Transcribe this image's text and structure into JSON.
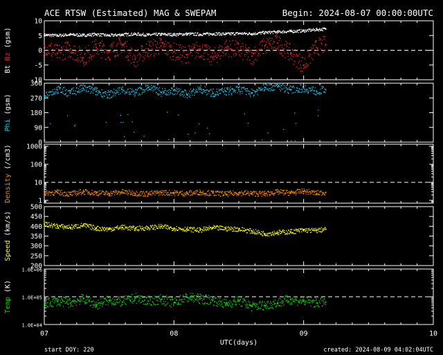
{
  "header": {
    "title": "ACE RTSW (Estimated) MAG & SWEPAM",
    "begin": "Begin: 2024-08-07 00:00:00UTC"
  },
  "footer": {
    "start_doy": "start DOY: 220",
    "created": "created: 2024-08-09 04:02:04UTC"
  },
  "colors": {
    "bt": "#ffffff",
    "bz": "#ff2020",
    "phi": "#22c8ee",
    "density": "#ff8a00",
    "speed": "#ffff00",
    "temp": "#00e000",
    "axis": "#ffffff",
    "background": "#000000"
  },
  "chart_data": [
    {
      "type": "scatter",
      "panel": "mag",
      "ylabel_parts": [
        "Bt",
        "Bz",
        "(gsm)"
      ],
      "ylim": [
        -10,
        10
      ],
      "yticks": [
        "10",
        "5",
        "0",
        "-5",
        "-10"
      ],
      "ref_lines": [
        0
      ],
      "series": [
        {
          "name": "Bt",
          "x": [
            0,
            0.1,
            0.2,
            0.3,
            0.4,
            0.5,
            0.6,
            0.7,
            0.8,
            0.9,
            1.0,
            1.1,
            1.2,
            1.3,
            1.4,
            1.5,
            1.6,
            1.7,
            1.8,
            1.9,
            2.0,
            2.1,
            2.17
          ],
          "values": [
            5.2,
            5.0,
            5.3,
            5.1,
            5.4,
            5.0,
            5.3,
            5.5,
            5.2,
            5.4,
            5.3,
            5.5,
            5.4,
            5.6,
            5.5,
            5.7,
            5.6,
            6.0,
            6.2,
            6.4,
            6.6,
            7.0,
            7.2
          ]
        },
        {
          "name": "Bz",
          "x": [
            0,
            0.1,
            0.2,
            0.3,
            0.4,
            0.5,
            0.6,
            0.7,
            0.8,
            0.9,
            1.0,
            1.1,
            1.2,
            1.3,
            1.4,
            1.5,
            1.6,
            1.7,
            1.8,
            1.9,
            2.0,
            2.1,
            2.17
          ],
          "values": [
            1.5,
            -1.0,
            0.5,
            -2.5,
            1.0,
            -0.5,
            2.0,
            -3.0,
            0.5,
            1.5,
            -0.5,
            -1.5,
            0.5,
            -2.5,
            1.0,
            0.0,
            -2.0,
            1.5,
            2.5,
            -1.0,
            -5.0,
            1.0,
            2.0
          ]
        }
      ]
    },
    {
      "type": "scatter",
      "panel": "phi",
      "ylabel_parts": [
        "Phi",
        "(gsm)"
      ],
      "ylim": [
        0,
        360
      ],
      "yticks": [
        "360",
        "270",
        "180",
        "90",
        "0"
      ],
      "series": [
        {
          "name": "Phi",
          "x": [
            0,
            0.1,
            0.2,
            0.3,
            0.4,
            0.5,
            0.6,
            0.7,
            0.8,
            0.9,
            1.0,
            1.1,
            1.2,
            1.3,
            1.4,
            1.5,
            1.6,
            1.7,
            1.8,
            1.9,
            2.0,
            2.1,
            2.17
          ],
          "values": [
            285,
            320,
            300,
            330,
            310,
            290,
            320,
            300,
            335,
            305,
            315,
            290,
            325,
            300,
            310,
            320,
            300,
            335,
            340,
            320,
            330,
            310,
            320
          ]
        }
      ]
    },
    {
      "type": "scatter",
      "panel": "density",
      "ylabel_parts": [
        "Density",
        "(/cm3)"
      ],
      "scale": "log",
      "ylim": [
        0.7,
        1300
      ],
      "yticks": [
        "1000",
        "100",
        "10",
        "1"
      ],
      "ref_lines": [
        10
      ],
      "series": [
        {
          "name": "Density",
          "x": [
            0,
            0.1,
            0.2,
            0.3,
            0.4,
            0.5,
            0.6,
            0.7,
            0.8,
            0.9,
            1.0,
            1.1,
            1.2,
            1.3,
            1.4,
            1.5,
            1.6,
            1.7,
            1.8,
            1.9,
            2.0,
            2.1,
            2.17
          ],
          "values": [
            2.5,
            2.8,
            2.2,
            3.0,
            2.6,
            2.4,
            2.9,
            2.5,
            2.3,
            2.7,
            2.6,
            2.4,
            2.8,
            2.5,
            2.2,
            2.6,
            2.4,
            2.3,
            2.9,
            2.6,
            3.2,
            2.5,
            2.8
          ]
        }
      ]
    },
    {
      "type": "scatter",
      "panel": "speed",
      "ylabel_parts": [
        "Speed",
        "(km/s)"
      ],
      "ylim": [
        200,
        500
      ],
      "yticks": [
        "500",
        "450",
        "400",
        "350",
        "300",
        "250",
        "200"
      ],
      "series": [
        {
          "name": "Speed",
          "x": [
            0,
            0.1,
            0.2,
            0.3,
            0.4,
            0.5,
            0.6,
            0.7,
            0.8,
            0.9,
            1.0,
            1.1,
            1.2,
            1.3,
            1.4,
            1.5,
            1.6,
            1.7,
            1.8,
            1.9,
            2.0,
            2.1,
            2.17
          ],
          "values": [
            410,
            400,
            395,
            405,
            390,
            385,
            395,
            388,
            392,
            398,
            390,
            385,
            380,
            392,
            388,
            385,
            375,
            362,
            368,
            372,
            380,
            378,
            385
          ]
        }
      ]
    },
    {
      "type": "scatter",
      "panel": "temp",
      "ylabel_parts": [
        "Temp",
        "(K)"
      ],
      "scale": "log",
      "ylim": [
        10000,
        1000000
      ],
      "yticks": [
        "1.0E+06",
        "1.0E+05",
        "1.0E+04"
      ],
      "ref_lines": [
        100000
      ],
      "series": [
        {
          "name": "Temp",
          "x": [
            0,
            0.1,
            0.2,
            0.3,
            0.4,
            0.5,
            0.6,
            0.7,
            0.8,
            0.9,
            1.0,
            1.1,
            1.2,
            1.3,
            1.4,
            1.5,
            1.6,
            1.7,
            1.8,
            1.9,
            2.0,
            2.1,
            2.17
          ],
          "values": [
            55000,
            70000,
            60000,
            85000,
            50000,
            75000,
            65000,
            90000,
            70000,
            80000,
            60000,
            95000,
            85000,
            75000,
            55000,
            70000,
            45000,
            50000,
            60000,
            80000,
            70000,
            60000,
            65000
          ]
        }
      ]
    }
  ],
  "x_axis": {
    "label": "UTC(days)",
    "ticks": [
      "07",
      "08",
      "09",
      "10"
    ]
  }
}
